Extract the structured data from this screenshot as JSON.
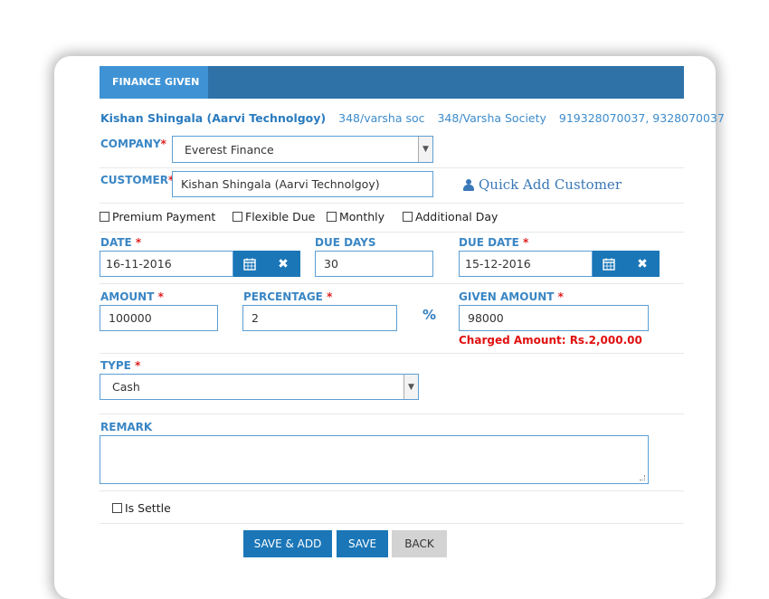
{
  "header": {
    "tab_label": "FINANCE GIVEN"
  },
  "customer_info": {
    "name": "Kishan Shingala (Aarvi Technolgoy)",
    "address1": "348/varsha soc",
    "address2": "348/Varsha Society",
    "phones": "919328070037, 9328070037"
  },
  "company": {
    "label": "COMPANY",
    "required_mark": "*",
    "value": "Everest Finance"
  },
  "customer": {
    "label": "CUSTOMER",
    "required_mark": "*",
    "value": "Kishan Shingala (Aarvi Technolgoy)",
    "quick_add_label": "Quick Add Customer"
  },
  "options": [
    {
      "label": "Premium Payment",
      "checked": false
    },
    {
      "label": "Flexible Due",
      "checked": false
    },
    {
      "label": "Monthly",
      "checked": false
    },
    {
      "label": "Additional Day",
      "checked": false
    }
  ],
  "date": {
    "label": "DATE",
    "required_mark": "*",
    "value": "16-11-2016"
  },
  "due_days": {
    "label": "DUE DAYS",
    "value": "30"
  },
  "due_date": {
    "label": "DUE DATE",
    "required_mark": "*",
    "value": "15-12-2016"
  },
  "amount": {
    "label": "AMOUNT",
    "required_mark": "*",
    "value": "100000"
  },
  "percentage": {
    "label": "PERCENTAGE",
    "required_mark": "*",
    "value": "2",
    "unit": "%"
  },
  "given_amount": {
    "label": "GIVEN AMOUNT",
    "required_mark": "*",
    "value": "98000",
    "charged_text": "Charged Amount: Rs.2,000.00"
  },
  "type": {
    "label": "TYPE",
    "required_mark": "*",
    "value": "Cash"
  },
  "remark": {
    "label": "REMARK",
    "value": ""
  },
  "is_settle": {
    "label": "Is Settle",
    "checked": false
  },
  "buttons": {
    "save_add": "SAVE & ADD",
    "save": "SAVE",
    "back": "BACK"
  }
}
